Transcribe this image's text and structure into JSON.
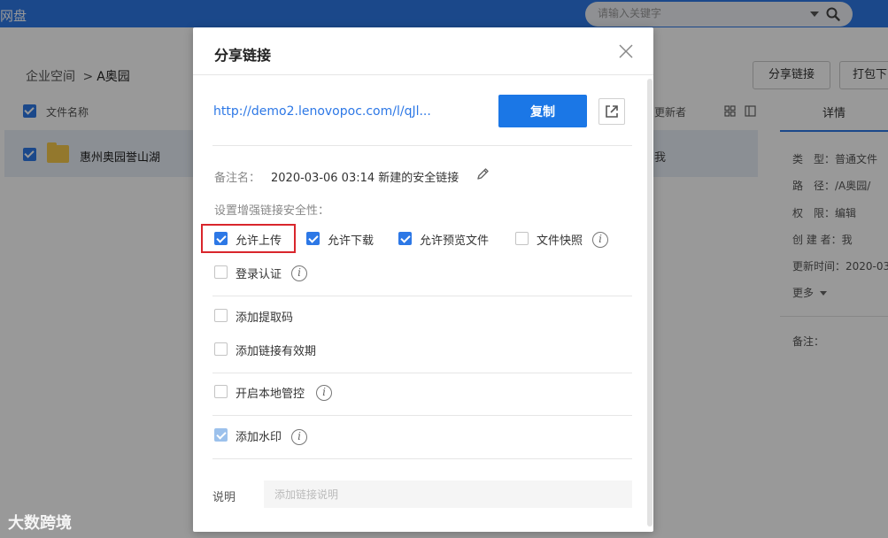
{
  "app": {
    "title": "网盘"
  },
  "search": {
    "placeholder": "请输入关键字"
  },
  "breadcrumb": {
    "root": "企业空间",
    "separator": ">",
    "current": "A奥园"
  },
  "toolbar": {
    "share_label": "分享链接",
    "pack_label": "打包下"
  },
  "file_list": {
    "col_name": "文件名称",
    "col_updater": "更新者",
    "rows": [
      {
        "name": "惠州奥园誉山湖",
        "updater": "我"
      }
    ]
  },
  "detail_panel": {
    "tab": "详情",
    "type": "类　型：普通文件",
    "path": "路　径：/A奥园/",
    "perm": "权　限：编辑",
    "creator": "创 建 者：我",
    "updated": "更新时间：2020-03",
    "more": "更多",
    "remark": "备注："
  },
  "dialog": {
    "title": "分享链接",
    "link_url": "http://demo2.lenovopoc.com/l/qJl...",
    "copy_label": "复制",
    "remark_label": "备注名：",
    "remark_value": "2020-03-06 03:14  新建的安全链接",
    "security_section": "设置增强链接安全性：",
    "options": {
      "allow_upload": {
        "label": "允许上传",
        "checked": true
      },
      "allow_download": {
        "label": "允许下载",
        "checked": true
      },
      "allow_preview": {
        "label": "允许预览文件",
        "checked": true
      },
      "file_snapshot": {
        "label": "文件快照",
        "checked": false
      },
      "login_auth": {
        "label": "登录认证",
        "checked": false
      },
      "extract_code": {
        "label": "添加提取码",
        "checked": false
      },
      "link_expiry": {
        "label": "添加链接有效期",
        "checked": false
      },
      "local_control": {
        "label": "开启本地管控",
        "checked": false
      },
      "watermark": {
        "label": "添加水印",
        "checked": true,
        "disabled": true
      }
    },
    "desc_label": "说明",
    "desc_placeholder": "添加链接说明"
  },
  "watermark_text": "大数跨境",
  "colors": {
    "brand_blue": "#2d78e6",
    "highlight_red": "#d9262c"
  }
}
